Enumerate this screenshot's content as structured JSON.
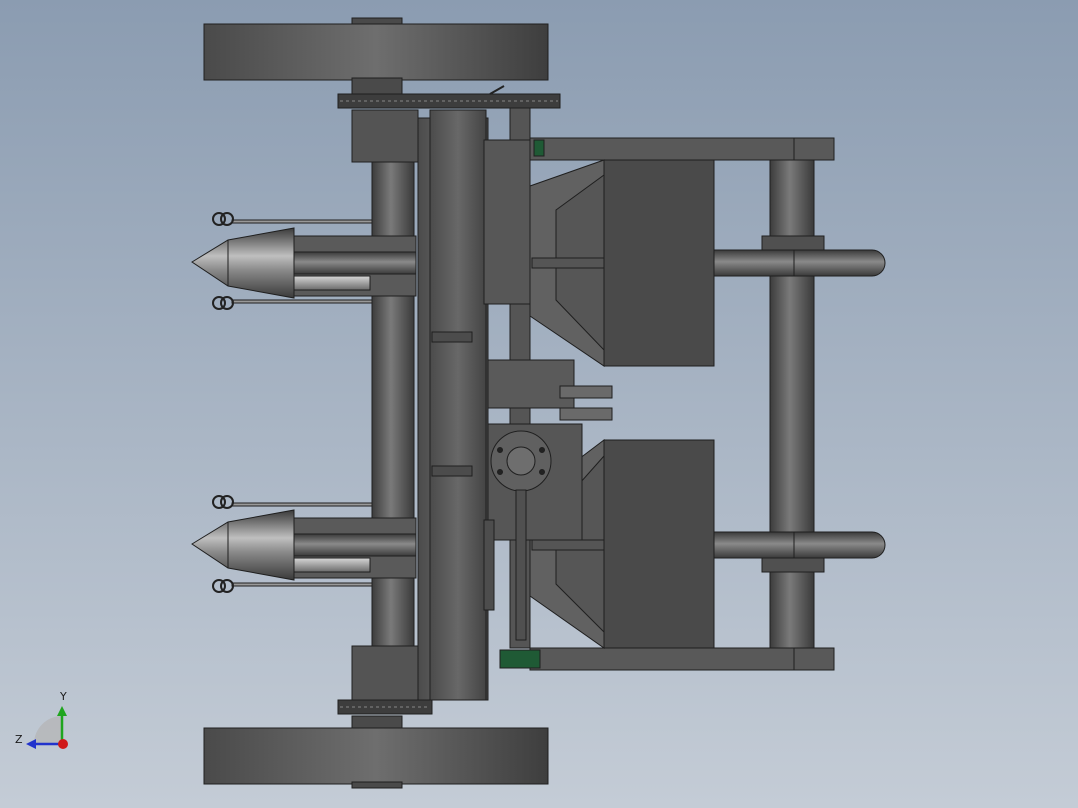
{
  "viewport": {
    "background": {
      "top": "#8b9cb1",
      "bottom": "#c4ccd6"
    },
    "body_color": "#5a5a5a",
    "edge_color": "#1f1f1f"
  },
  "triad": {
    "y_label": "Y",
    "z_label": "Z",
    "y_color": "#1fa51f",
    "z_color": "#2233cc",
    "x_dot_color": "#d01818"
  }
}
